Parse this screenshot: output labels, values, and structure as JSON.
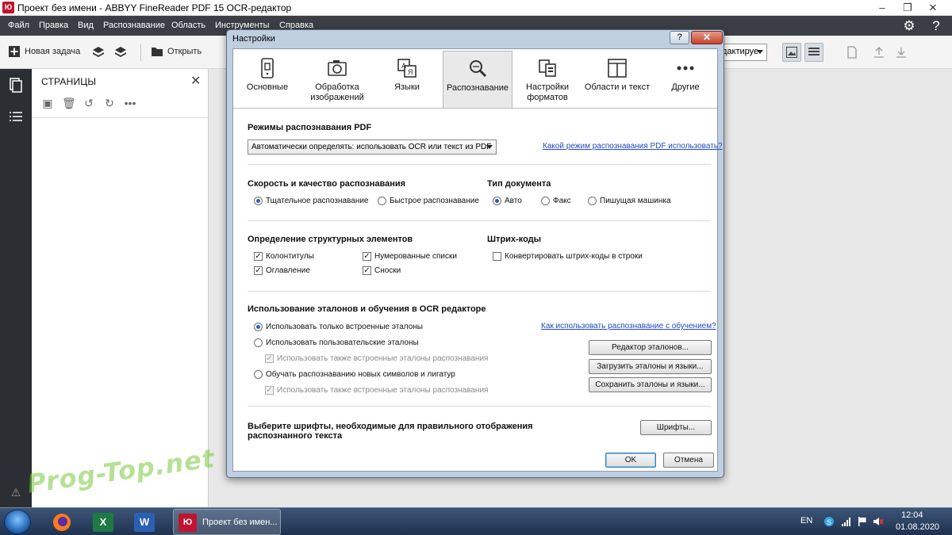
{
  "window": {
    "title": "Проект без имени - ABBYY FineReader PDF 15 OCR-редактор",
    "logo": "Ю"
  },
  "menu": {
    "items": [
      "Файл",
      "Правка",
      "Вид",
      "Распознавание",
      "Область",
      "Инструменты",
      "Справка"
    ]
  },
  "toolbar": {
    "new_task": "Новая задача",
    "open": "Открыть",
    "mode_dropdown": "дактируе"
  },
  "pages_panel": {
    "title": "СТРАНИЦЫ"
  },
  "dialog": {
    "title": "Настройки",
    "help": "?",
    "close": "✕",
    "tabs": [
      {
        "label": "Основные",
        "icon": "phone-settings-icon"
      },
      {
        "label": "Обработка изображений",
        "icon": "camera-icon"
      },
      {
        "label": "Языки",
        "icon": "languages-icon"
      },
      {
        "label": "Распознавание",
        "icon": "magnifier-icon"
      },
      {
        "label": "Настройки форматов",
        "icon": "format-documents-icon"
      },
      {
        "label": "Области и текст",
        "icon": "columns-icon"
      },
      {
        "label": "Другие",
        "icon": "more-dots-icon"
      }
    ],
    "pdf_modes": {
      "title": "Режимы распознавания PDF",
      "select_value": "Автоматически определять: использовать OCR или текст из PDF",
      "link": "Какой режим распознавания PDF использовать?"
    },
    "speed": {
      "title": "Скорость и качество распознавания",
      "options": [
        {
          "label": "Тщательное распознавание",
          "checked": true
        },
        {
          "label": "Быстрое распознавание",
          "checked": false
        }
      ]
    },
    "doc_type": {
      "title": "Тип документа",
      "options": [
        {
          "label": "Авто",
          "checked": true
        },
        {
          "label": "Факс",
          "checked": false
        },
        {
          "label": "Пишущая машинка",
          "checked": false
        }
      ]
    },
    "structure": {
      "title": "Определение структурных элементов",
      "options": [
        {
          "label": "Колонтитулы",
          "checked": true
        },
        {
          "label": "Нумерованные списки",
          "checked": true
        },
        {
          "label": "Оглавление",
          "checked": true
        },
        {
          "label": "Сноски",
          "checked": true
        }
      ]
    },
    "barcodes": {
      "title": "Штрих-коды",
      "option": {
        "label": "Конвертировать штрих-коды в строки",
        "checked": false
      }
    },
    "patterns": {
      "title": "Использование эталонов и обучения в OCR редакторе",
      "link": "Как использовать распознавание с обучением?",
      "opt_builtin": "Использовать только встроенные эталоны",
      "opt_user": "Использовать пользовательские эталоны",
      "sub_also_1": "Использовать также встроенные эталоны распознавания",
      "opt_train": "Обучать распознаванию новых символов и лигатур",
      "sub_also_2": "Использовать также встроенные эталоны распознавания",
      "btn_editor": "Редактор эталонов...",
      "btn_load": "Загрузить эталоны и языки...",
      "btn_save": "Сохранить эталоны и языки..."
    },
    "fonts": {
      "text": "Выберите шрифты, необходимые для правильного отображения распознанного текста",
      "button": "Шрифты..."
    },
    "ok": "OK",
    "cancel": "Отмена"
  },
  "taskbar": {
    "active_task": "Проект без имен...",
    "lang": "EN",
    "time": "12:04",
    "date": "01.08.2020"
  },
  "watermark": "Prog-Top.net",
  "colors": {
    "menubar": "#3b3f45",
    "leftrail": "#2b2f33",
    "brand": "#c0152f",
    "link": "#1f4bbd",
    "radio_dot": "#2463b6"
  }
}
